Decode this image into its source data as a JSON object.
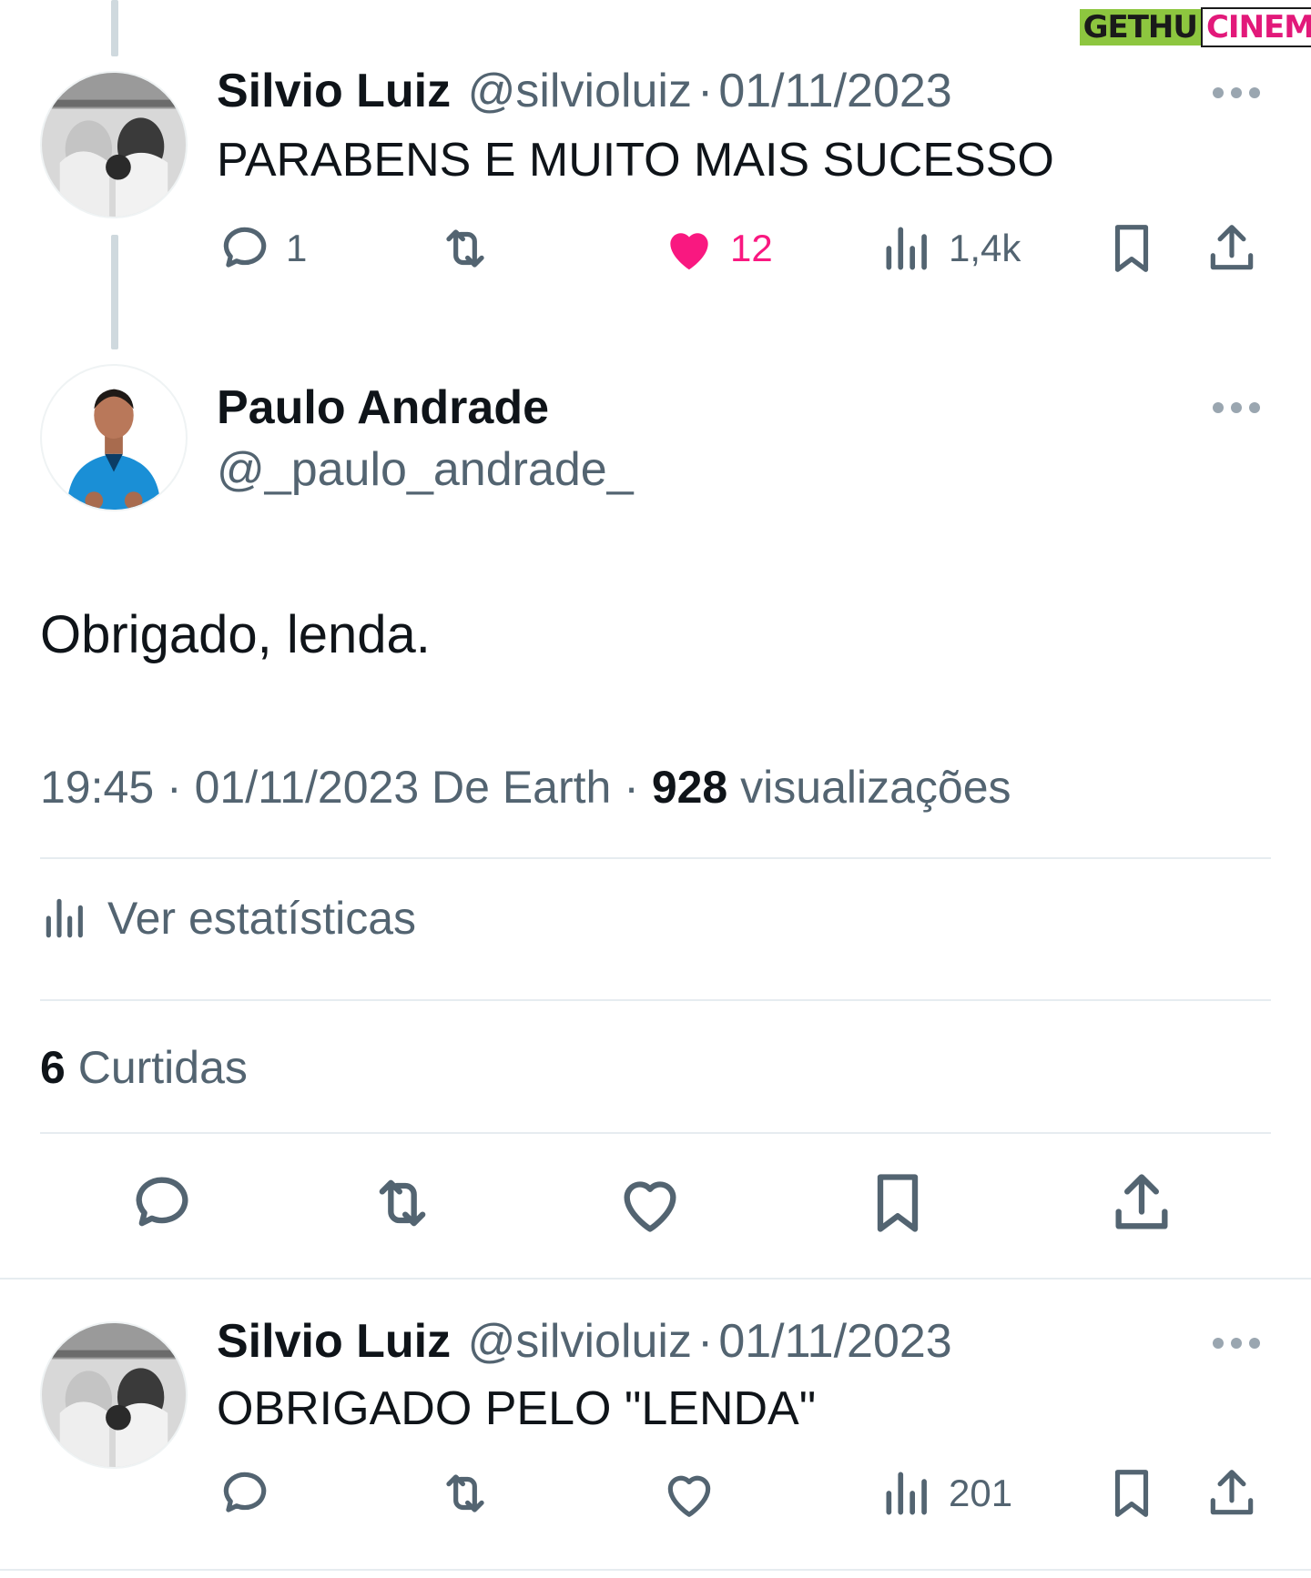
{
  "watermark": {
    "part1": "GETHU",
    "part2": "CINEMA"
  },
  "tweets": [
    {
      "name": "Silvio Luiz",
      "handle": "@silvioluiz",
      "sep": "·",
      "date": "01/11/2023",
      "text": "PARABENS E MUITO MAIS SUCESSO",
      "replies": "1",
      "likes": "12",
      "views": "1,4k",
      "liked": true
    },
    {
      "name": "Silvio Luiz",
      "handle": "@silvioluiz",
      "sep": "·",
      "date": "01/11/2023",
      "text": "OBRIGADO PELO \"LENDA\"",
      "views": "201",
      "liked": false
    }
  ],
  "main_tweet": {
    "name": "Paulo Andrade",
    "handle": "@_paulo_andrade_",
    "text": "Obrigado, lenda.",
    "time": "19:45",
    "sep1": "·",
    "date_source": "01/11/2023 De Earth",
    "sep2": "·",
    "views_count": "928",
    "views_label": "visualizações",
    "stats_label": "Ver estatísticas",
    "likes_count": "6",
    "likes_label": "Curtidas"
  },
  "colors": {
    "like_active": "#f91880",
    "icon_gray": "#536471",
    "watermark_green": "#8dc63f",
    "watermark_pink": "#e2197a"
  },
  "icons": [
    "more-icon",
    "reply-icon",
    "retweet-icon",
    "like-icon",
    "views-icon",
    "bookmark-icon",
    "share-icon"
  ]
}
